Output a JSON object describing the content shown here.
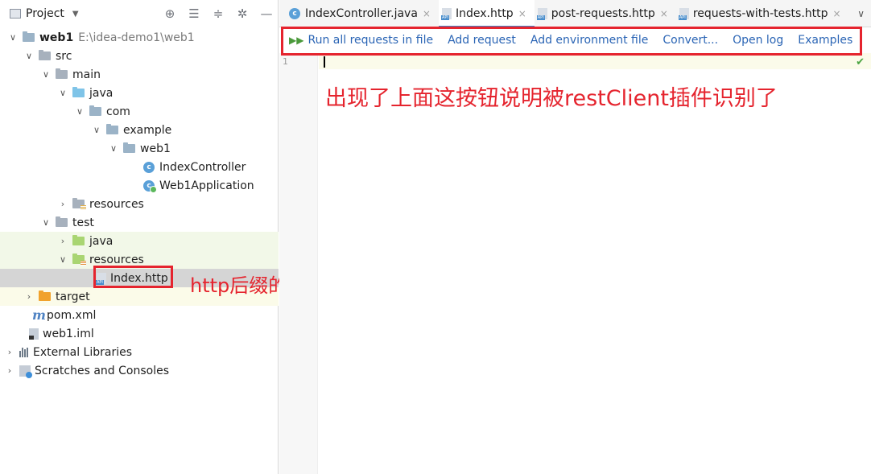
{
  "project_panel": {
    "title": "Project",
    "header_tools": {
      "locate": "⊕",
      "collapse": "☰",
      "expand": "≑",
      "settings": "✲",
      "hide": "—"
    },
    "tree": [
      {
        "label": "web1",
        "path": "E:\\idea-demo1\\web1",
        "bold": true
      },
      {
        "label": "src"
      },
      {
        "label": "main"
      },
      {
        "label": "java"
      },
      {
        "label": "com"
      },
      {
        "label": "example"
      },
      {
        "label": "web1"
      },
      {
        "label": "IndexController"
      },
      {
        "label": "Web1Application"
      },
      {
        "label": "resources"
      },
      {
        "label": "test"
      },
      {
        "label": "java"
      },
      {
        "label": "resources"
      },
      {
        "label": "Index.http"
      },
      {
        "label": "target"
      },
      {
        "label": "pom.xml"
      },
      {
        "label": "web1.iml"
      },
      {
        "label": "External Libraries"
      },
      {
        "label": "Scratches and Consoles"
      }
    ]
  },
  "editor": {
    "tabs": [
      {
        "label": "IndexController.java",
        "icon": "class-icon"
      },
      {
        "label": "Index.http",
        "icon": "http-file-icon",
        "active": true
      },
      {
        "label": "post-requests.http",
        "icon": "http-file-icon"
      },
      {
        "label": "requests-with-tests.http",
        "icon": "http-file-icon"
      }
    ],
    "toolbar": {
      "run_all": "Run all requests in file",
      "add_request": "Add request",
      "add_env": "Add environment file",
      "convert": "Convert...",
      "open_log": "Open log",
      "examples": "Examples"
    },
    "line_number": "1"
  },
  "annotations": {
    "toolbar_note": "出现了上面这按钮说明被restClient插件识别了",
    "file_note": "http后缀的文件"
  },
  "colors": {
    "annotation_red": "#e5242e",
    "link_blue": "#2b65b5",
    "tab_active_underline": "#4083c9"
  }
}
